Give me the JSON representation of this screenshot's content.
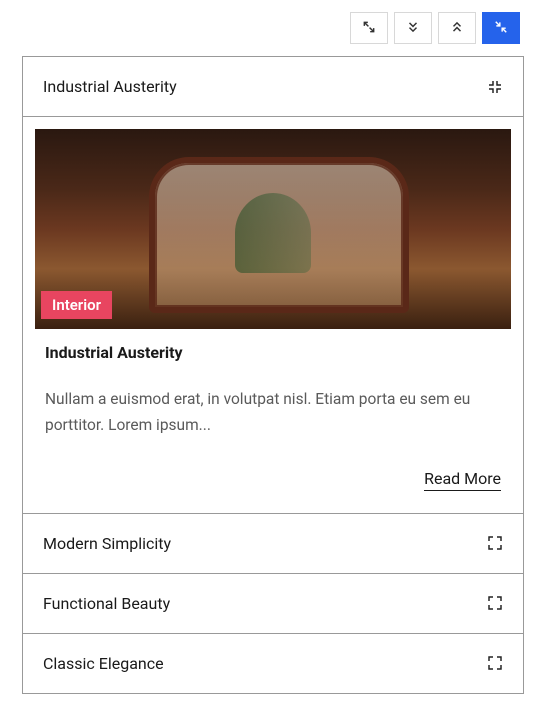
{
  "toolbar": {
    "items": [
      {
        "name": "expand-all-button",
        "icon": "expand-fullscreen",
        "active": false
      },
      {
        "name": "scroll-down-button",
        "icon": "chevron-double-down",
        "active": false
      },
      {
        "name": "scroll-up-button",
        "icon": "chevron-double-up",
        "active": false
      },
      {
        "name": "collapse-all-button",
        "icon": "collapse-fullscreen",
        "active": true
      }
    ]
  },
  "accordion": {
    "items": [
      {
        "title": "Industrial Austerity",
        "expanded": true,
        "icon": "collapse-icon",
        "card": {
          "badge": "Interior",
          "title": "Industrial Austerity",
          "excerpt": "Nullam a euismod erat, in volutpat nisl. Etiam porta eu sem eu porttitor. Lorem ipsum...",
          "readmore": "Read More"
        }
      },
      {
        "title": "Modern Simplicity",
        "expanded": false,
        "icon": "expand-icon"
      },
      {
        "title": "Functional Beauty",
        "expanded": false,
        "icon": "expand-icon"
      },
      {
        "title": "Classic Elegance",
        "expanded": false,
        "icon": "expand-icon"
      }
    ]
  },
  "colors": {
    "accent": "#2563eb",
    "badge": "#e84560"
  }
}
